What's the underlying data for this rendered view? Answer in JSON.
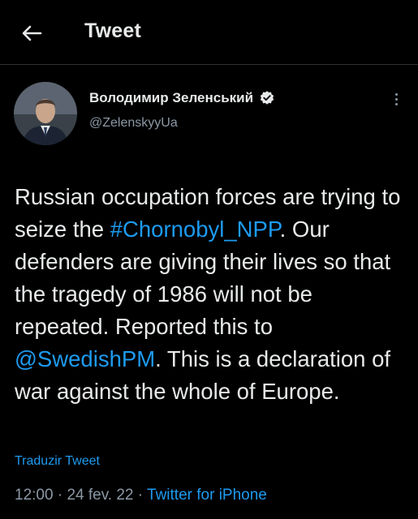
{
  "header": {
    "title": "Tweet",
    "back_icon": "arrow-left-icon"
  },
  "tweet": {
    "author_name": "Володимир Зеленський",
    "handle": "@ZelenskyyUa",
    "verified_icon": "verified-badge-icon",
    "more_icon": "more-vertical-icon",
    "text_segments": [
      {
        "text": "Russian occupation forces are trying to seize the ",
        "link": false
      },
      {
        "text": "#Chornobyl_NPP",
        "link": true
      },
      {
        "text": ". Our defenders are giving their lives so that the tragedy of 1986 will not be repeated. Reported this to ",
        "link": false
      },
      {
        "text": "@SwedishPM",
        "link": true
      },
      {
        "text": ". This is a declaration of war against the whole of Europe.",
        "link": false
      }
    ],
    "translate_label": "Traduzir Tweet",
    "time": "12:00",
    "date": "24 fev. 22",
    "source": "Twitter for iPhone"
  },
  "colors": {
    "accent": "#1d9bf0",
    "secondary_text": "#8b98a5",
    "background": "#000000"
  }
}
